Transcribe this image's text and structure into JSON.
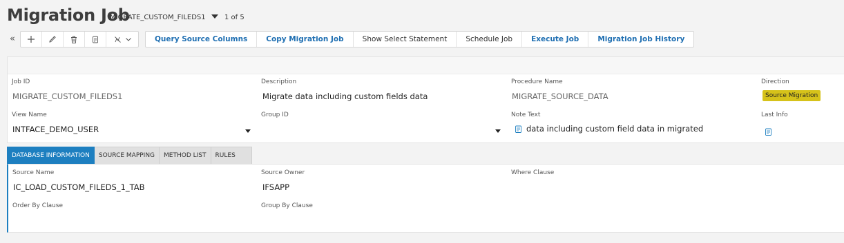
{
  "header": {
    "title": "Migration Job",
    "record_selector": "MIGRATE_CUSTOM_FILEDS1",
    "record_count": "1 of 5"
  },
  "toolbar": {
    "collapse_glyph": "«",
    "icons": [
      "add-icon",
      "edit-icon",
      "delete-icon",
      "duplicate-icon",
      "more-actions-icon"
    ],
    "commands": [
      {
        "label": "Query Source Columns",
        "style": "link"
      },
      {
        "label": "Copy Migration Job",
        "style": "link"
      },
      {
        "label": "Show Select Statement",
        "style": "plain"
      },
      {
        "label": "Schedule Job",
        "style": "plain"
      },
      {
        "label": "Execute Job",
        "style": "link"
      },
      {
        "label": "Migration Job History",
        "style": "link"
      }
    ]
  },
  "fields": {
    "job_id": {
      "label": "Job ID",
      "value": "MIGRATE_CUSTOM_FILEDS1"
    },
    "description": {
      "label": "Description",
      "value": "Migrate data including custom fields data"
    },
    "procedure_name": {
      "label": "Procedure Name",
      "value": "MIGRATE_SOURCE_DATA"
    },
    "direction": {
      "label": "Direction",
      "value": "Source Migration"
    },
    "view_name": {
      "label": "View Name",
      "value": "INTFACE_DEMO_USER"
    },
    "group_id": {
      "label": "Group ID",
      "value": ""
    },
    "note_text": {
      "label": "Note Text",
      "value": "data including custom field data in migrated"
    },
    "last_info": {
      "label": "Last Info",
      "value": ""
    }
  },
  "tabs": [
    "DATABASE INFORMATION",
    "SOURCE MAPPING",
    "METHOD LIST",
    "RULES"
  ],
  "active_tab": "DATABASE INFORMATION",
  "db_info": {
    "source_name": {
      "label": "Source Name",
      "value": "IC_LOAD_CUSTOM_FILEDS_1_TAB"
    },
    "source_owner": {
      "label": "Source Owner",
      "value": "IFSAPP"
    },
    "where_clause": {
      "label": "Where Clause",
      "value": ""
    },
    "order_by": {
      "label": "Order By Clause",
      "value": ""
    },
    "group_by": {
      "label": "Group By Clause",
      "value": ""
    }
  },
  "colors": {
    "accent": "#1d7fc0",
    "link": "#1f6fb2",
    "direction_badge": "#d6c21a",
    "background": "#f3f3f3"
  }
}
